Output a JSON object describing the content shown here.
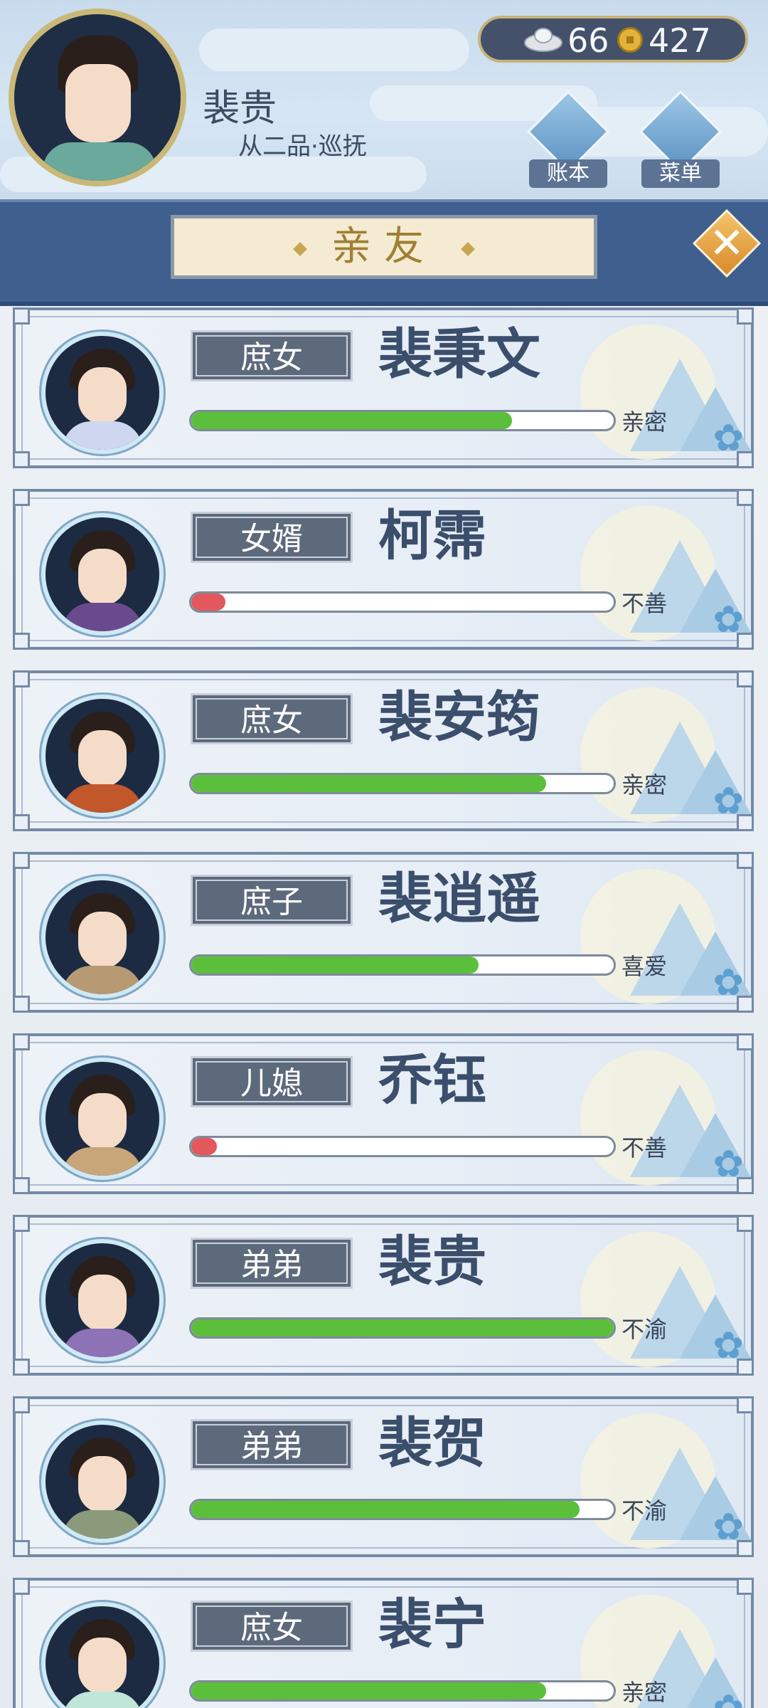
{
  "player": {
    "name": "裴贵",
    "rank": "从二品·巡抚"
  },
  "currency": {
    "silver": "66",
    "copper": "427"
  },
  "header_buttons": {
    "ledger": "账本",
    "menu": "菜单"
  },
  "title": "亲友",
  "close_symbol": "✕",
  "colors": {
    "green_bar": "#5bbf3c",
    "red_bar": "#e2585c",
    "banner": "#3f5f8f"
  },
  "members": [
    {
      "relation": "庶女",
      "name": "裴秉文",
      "status": "亲密",
      "favor": 0.76,
      "bar_color": "green",
      "robe": "#cfd7f0"
    },
    {
      "relation": "女婿",
      "name": "柯霈",
      "status": "不善",
      "favor": 0.08,
      "bar_color": "red",
      "robe": "#6a4a8f"
    },
    {
      "relation": "庶女",
      "name": "裴安筠",
      "status": "亲密",
      "favor": 0.84,
      "bar_color": "green",
      "robe": "#c2572c"
    },
    {
      "relation": "庶子",
      "name": "裴逍遥",
      "status": "喜爱",
      "favor": 0.68,
      "bar_color": "green",
      "robe": "#b79a73"
    },
    {
      "relation": "儿媳",
      "name": "乔钰",
      "status": "不善",
      "favor": 0.05,
      "bar_color": "red",
      "robe": "#c9a57a"
    },
    {
      "relation": "弟弟",
      "name": "裴贵",
      "status": "不渝",
      "favor": 1.0,
      "bar_color": "green",
      "robe": "#8e72b6"
    },
    {
      "relation": "弟弟",
      "name": "裴贺",
      "status": "不渝",
      "favor": 0.92,
      "bar_color": "green",
      "robe": "#8b9a7a"
    },
    {
      "relation": "庶女",
      "name": "裴宁",
      "status": "亲密",
      "favor": 0.84,
      "bar_color": "green",
      "robe": "#bfe6d8"
    }
  ]
}
